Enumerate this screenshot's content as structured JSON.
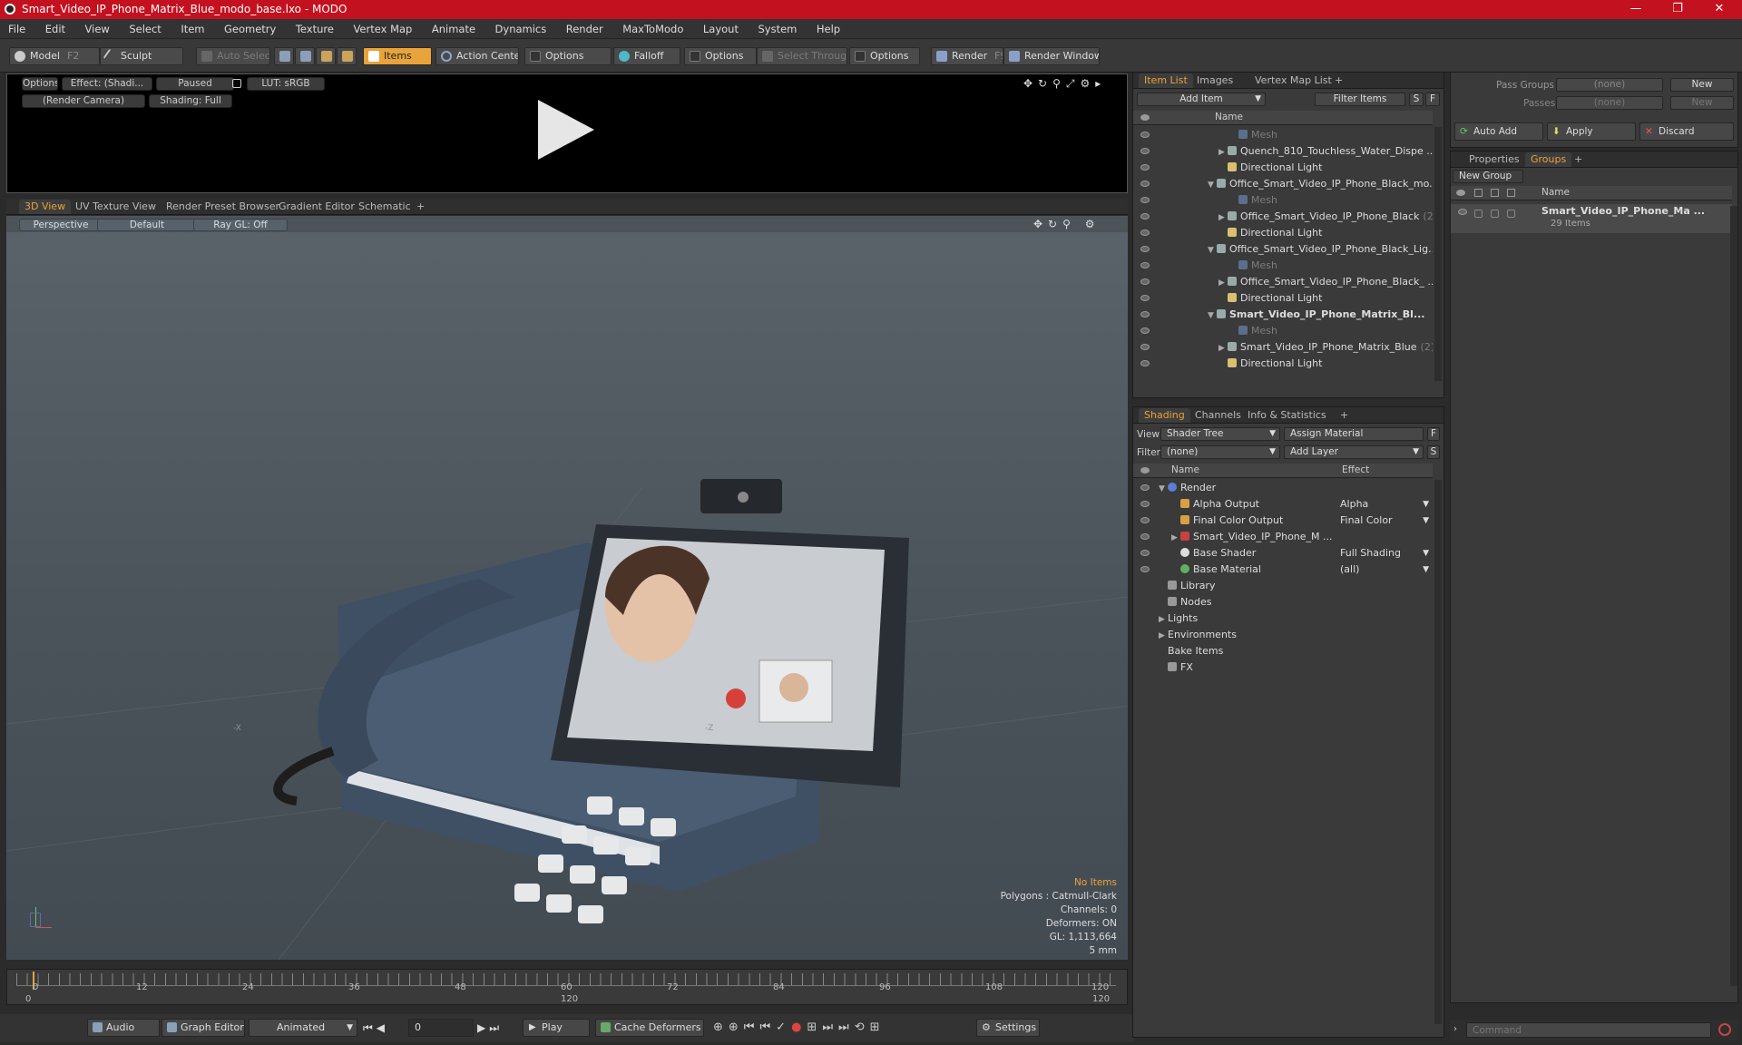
{
  "window": {
    "title": "Smart_Video_IP_Phone_Matrix_Blue_modo_base.lxo - MODO",
    "min": "—",
    "max": "❐",
    "close": "✕"
  },
  "menu": [
    "File",
    "Edit",
    "View",
    "Select",
    "Item",
    "Geometry",
    "Texture",
    "Vertex Map",
    "Animate",
    "Dynamics",
    "Render",
    "MaxToModo",
    "Layout",
    "System",
    "Help"
  ],
  "toolbar": {
    "model": "Model",
    "model_key": "F2",
    "sculpt": "Sculpt",
    "auto_select": "Auto Select",
    "items": "Items",
    "action_center": "Action Center",
    "options1": "Options",
    "falloff": "Falloff",
    "options2": "Options",
    "select_through": "Select Through",
    "options3": "Options",
    "render": "Render",
    "render_key": "F9",
    "render_window": "Render Window"
  },
  "preview": {
    "options": "Options",
    "effect": "Effect: (Shadi...",
    "paused": "Paused",
    "lut": "LUT: sRGB",
    "camera": "(Render Camera)",
    "shading": "Shading: Full"
  },
  "view_tabs": [
    "3D View",
    "UV Texture View",
    "Render Preset Browser",
    "Gradient Editor",
    "Schematic",
    "+"
  ],
  "viewport": {
    "perspective": "Perspective",
    "default": "Default",
    "raygl": "Ray GL: Off",
    "info": {
      "items": "No Items",
      "polygons": "Polygons : Catmull-Clark",
      "channels": "Channels: 0",
      "deformers": "Deformers: ON",
      "gl": "GL: 1,113,664",
      "unit": "5 mm"
    },
    "axis_x": "-X",
    "axis_z": "-Z"
  },
  "timeline": {
    "ticks": [
      "0",
      "12",
      "24",
      "36",
      "48",
      "60",
      "72",
      "84",
      "96",
      "108",
      "120"
    ],
    "start": "0",
    "end": "120",
    "end2": "120",
    "mid": "120"
  },
  "bottombar": {
    "audio": "Audio",
    "graph_editor": "Graph Editor",
    "animated": "Animated",
    "frame": "0",
    "play": "Play",
    "cache": "Cache Deformers",
    "settings": "Settings"
  },
  "itemlist": {
    "tabs": [
      "Item List",
      "Images",
      "Vertex Map List",
      "+"
    ],
    "add_item": "Add Item",
    "filter": "Filter Items",
    "s": "S",
    "f": "F",
    "col_name": "Name",
    "rows": [
      {
        "label": "Mesh",
        "indent": 3,
        "dim": true
      },
      {
        "label": "Quench_810_Touchless_Water_Dispe ...",
        "indent": 2,
        "arrow": "▶"
      },
      {
        "label": "Directional Light",
        "indent": 2
      },
      {
        "label": "Office_Smart_Video_IP_Phone_Black_mo...",
        "indent": 1,
        "arrow": "▼"
      },
      {
        "label": "Mesh",
        "indent": 3,
        "dim": true
      },
      {
        "label": "Office_Smart_Video_IP_Phone_Black",
        "suffix": "(2)",
        "indent": 2,
        "arrow": "▶"
      },
      {
        "label": "Directional Light",
        "indent": 2
      },
      {
        "label": "Office_Smart_Video_IP_Phone_Black_Lig...",
        "indent": 1,
        "arrow": "▼"
      },
      {
        "label": "Mesh",
        "indent": 3,
        "dim": true
      },
      {
        "label": "Office_Smart_Video_IP_Phone_Black_ ...",
        "indent": 2,
        "arrow": "▶"
      },
      {
        "label": "Directional Light",
        "indent": 2
      },
      {
        "label": "Smart_Video_IP_Phone_Matrix_Bl...",
        "indent": 1,
        "arrow": "▼",
        "bold": true
      },
      {
        "label": "Mesh",
        "indent": 3,
        "dim": true
      },
      {
        "label": "Smart_Video_IP_Phone_Matrix_Blue",
        "suffix": "(2)",
        "indent": 2,
        "arrow": "▶"
      },
      {
        "label": "Directional Light",
        "indent": 2
      }
    ]
  },
  "shading": {
    "tabs": [
      "Shading",
      "Channels",
      "Info & Statistics",
      "+"
    ],
    "view_label": "View",
    "view_value": "Shader Tree",
    "assign": "Assign Material",
    "f": "F",
    "filter_label": "Filter",
    "filter_value": "(none)",
    "add_layer": "Add Layer",
    "s": "S",
    "col_name": "Name",
    "col_effect": "Effect",
    "rows": [
      {
        "label": "Render",
        "effect": "",
        "indent": 0,
        "arrow": "▼",
        "icon": "#5b7fd6"
      },
      {
        "label": "Alpha Output",
        "effect": "Alpha",
        "indent": 1,
        "icon": "#d8a040"
      },
      {
        "label": "Final Color Output",
        "effect": "Final Color",
        "indent": 1,
        "icon": "#d8a040"
      },
      {
        "label": "Smart_Video_IP_Phone_M ...",
        "effect": "",
        "indent": 1,
        "arrow": "▶",
        "icon": "#c84040"
      },
      {
        "label": "Base Shader",
        "effect": "Full Shading",
        "indent": 1,
        "icon": "#dddddd"
      },
      {
        "label": "Base Material",
        "effect": "(all)",
        "indent": 1,
        "icon": "#60b060"
      },
      {
        "label": "Library",
        "effect": "",
        "indent": 0,
        "icon": "#999999"
      },
      {
        "label": "Nodes",
        "effect": "",
        "indent": 0,
        "icon": "#999999"
      },
      {
        "label": "Lights",
        "effect": "",
        "indent": 0,
        "arrow": "▶"
      },
      {
        "label": "Environments",
        "effect": "",
        "indent": 0,
        "arrow": "▶"
      },
      {
        "label": "Bake Items",
        "effect": "",
        "indent": 0
      },
      {
        "label": "FX",
        "effect": "",
        "indent": 0,
        "icon": "#999999"
      }
    ]
  },
  "passes": {
    "pass_groups": "Pass Groups",
    "pass_value": "(none)",
    "new": "New",
    "passes": "Passes",
    "passes_value": "(none)",
    "new2": "New",
    "auto_add": "Auto Add",
    "apply": "Apply",
    "discard": "Discard"
  },
  "groups": {
    "tabs": [
      "Properties",
      "Groups",
      "+"
    ],
    "new_group": "New Group",
    "col_name": "Name",
    "group_name": "Smart_Video_IP_Phone_Ma ...",
    "group_count": "29 Items"
  },
  "command": {
    "placeholder": "Command"
  },
  "colors": {
    "accent": "#e8a33a",
    "title_bar": "#c4111f"
  }
}
